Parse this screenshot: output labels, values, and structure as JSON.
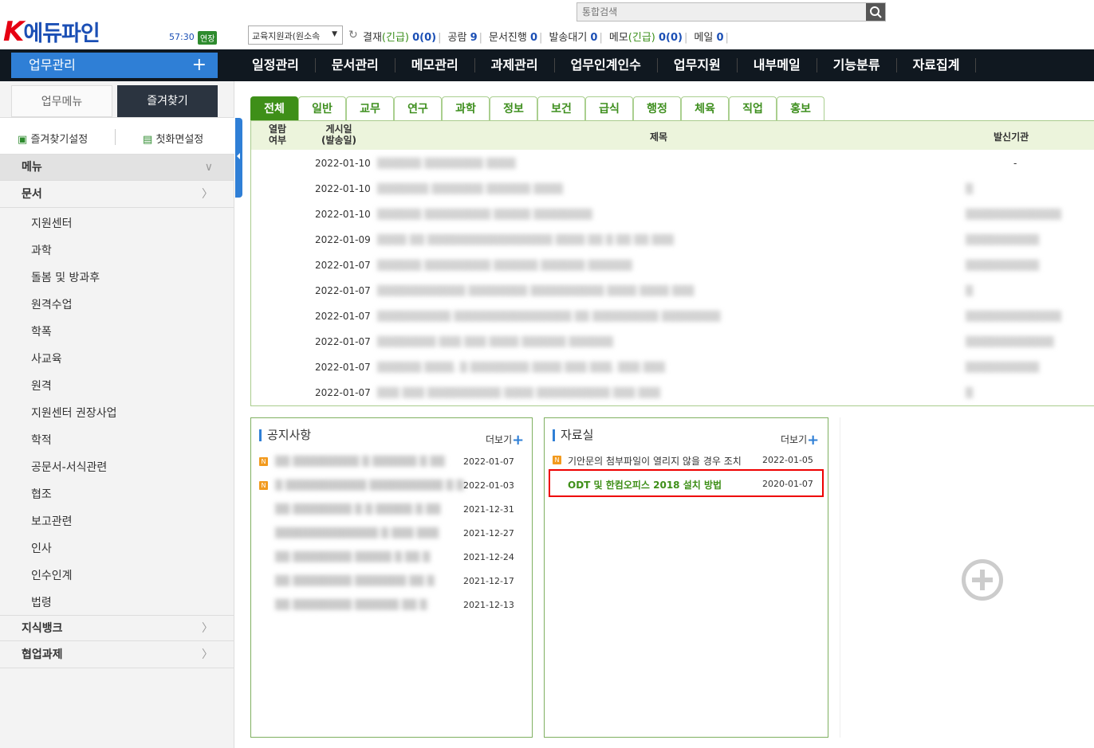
{
  "header": {
    "logo_k": "K",
    "logo_text": "에듀파인",
    "timer": "57:30",
    "extend": "연장",
    "search_placeholder": "통합검색",
    "dept": "교육지원과(원소속",
    "status": [
      {
        "label": "결재",
        "paren": "(긴급)",
        "count": "0(0)"
      },
      {
        "label": "공람",
        "paren": "",
        "count": "9"
      },
      {
        "label": "문서진행",
        "paren": "",
        "count": "0"
      },
      {
        "label": "발송대기",
        "paren": "",
        "count": "0"
      },
      {
        "label": "메모",
        "paren": "(긴급)",
        "count": "0(0)"
      },
      {
        "label": "메일",
        "paren": "",
        "count": "0"
      }
    ]
  },
  "nav": {
    "home": "업무관리",
    "home_plus": "+",
    "items": [
      "일정관리",
      "문서관리",
      "메모관리",
      "과제관리",
      "업무인계인수",
      "업무지원",
      "내부메일",
      "기능분류",
      "자료집계"
    ]
  },
  "sidebar": {
    "tab1": "업무메뉴",
    "tab2": "즐겨찾기",
    "fav_settings": "즐겨찾기설정",
    "first_screen": "첫화면설정",
    "menu_head": "메뉴",
    "doc_head": "문서",
    "items": [
      "지원센터",
      "과학",
      "돌봄 및 방과후",
      "원격수업",
      "학폭",
      "사교육",
      "원격",
      "지원센터 권장사업",
      "학적",
      "공문서-서식관련",
      "협조",
      "보고관련",
      "인사",
      "인수인계",
      "법령"
    ],
    "knowledge": "지식뱅크",
    "collab": "협업과제"
  },
  "tabs": [
    "전체",
    "일반",
    "교무",
    "연구",
    "과학",
    "정보",
    "보건",
    "급식",
    "행정",
    "체육",
    "직업",
    "홍보"
  ],
  "board": {
    "col_read": "열람\n여부",
    "col_date": "게시일\n(발송일)",
    "col_title": "제목",
    "col_sender": "발신기관",
    "rows": [
      {
        "date": "2022-01-10",
        "title": "▒▒▒▒▒▒ ▒▒▒▒▒▒▒▒ ▒▒▒▒",
        "sender": "-"
      },
      {
        "date": "2022-01-10",
        "title": "▒▒▒▒▒▒▒ ▒▒▒▒▒▒▒ ▒▒▒▒▒▒ ▒▒▒▒",
        "sender": "▒"
      },
      {
        "date": "2022-01-10",
        "title": "▒▒▒▒▒▒ ▒▒▒▒▒▒▒▒▒ ▒▒▒▒▒ ▒▒▒▒▒▒▒▒",
        "sender": "▒▒▒▒▒▒▒▒▒▒▒▒▒"
      },
      {
        "date": "2022-01-09",
        "title": "▒▒▒▒ ▒▒ ▒▒▒▒▒▒▒▒▒▒▒▒▒▒▒▒▒ ▒▒▒▒ ▒▒ ▒ ▒▒ ▒▒ ▒▒▒",
        "sender": "▒▒▒▒▒▒▒▒▒▒"
      },
      {
        "date": "2022-01-07",
        "title": "▒▒▒▒▒▒ ▒▒▒▒▒▒▒▒▒ ▒▒▒▒▒▒ ▒▒▒▒▒▒ ▒▒▒▒▒▒",
        "sender": "▒▒▒▒▒▒▒▒▒▒"
      },
      {
        "date": "2022-01-07",
        "title": "▒▒▒▒▒▒▒▒▒▒▒▒ ▒▒▒▒▒▒▒▒ ▒▒▒▒▒▒▒▒▒▒ ▒▒▒▒ ▒▒▒▒ ▒▒▒",
        "sender": "▒"
      },
      {
        "date": "2022-01-07",
        "title": "▒▒▒▒▒▒▒▒▒▒ ▒▒▒▒▒▒▒▒▒▒▒▒▒▒▒▒ ▒▒ ▒▒▒▒▒▒▒▒▒ ▒▒▒▒▒▒▒▒",
        "sender": "▒▒▒▒▒▒▒▒▒▒▒▒▒"
      },
      {
        "date": "2022-01-07",
        "title": "▒▒▒▒▒▒▒▒ ▒▒▒ ▒▒▒ ▒▒▒▒ ▒▒▒▒▒▒ ▒▒▒▒▒▒",
        "sender": "▒▒▒▒▒▒▒▒▒▒▒▒"
      },
      {
        "date": "2022-01-07",
        "title": "▒▒▒▒▒▒ ▒▒▒▒. ▒ ▒▒▒▒▒▒▒▒ ▒▒▒▒ ▒▒▒ ▒▒▒. ▒▒▒ ▒▒▒",
        "sender": "▒▒▒▒▒▒▒▒▒▒"
      },
      {
        "date": "2022-01-07",
        "title": "▒▒▒ ▒▒▒ ▒▒▒▒▒▒▒▒▒▒ ▒▒▒▒ ▒▒▒▒▒▒▒▒▒▒ ▒▒▒ ▒▒▒",
        "sender": "▒"
      }
    ]
  },
  "notice": {
    "title": "공지사항",
    "more": "더보기",
    "rows": [
      {
        "new": true,
        "title": "▒▒ ▒▒▒▒▒▒▒▒▒ ▒ ▒▒▒▒▒▒ ▒ ▒▒",
        "date": "2022-01-07"
      },
      {
        "new": true,
        "title": "▒ ▒▒▒▒▒▒▒▒▒▒▒ ▒▒▒▒▒▒▒▒▒▒ ▒ ▒",
        "date": "2022-01-03"
      },
      {
        "new": false,
        "title": "▒▒ ▒▒▒▒▒▒▒▒ ▒ ▒ ▒▒▒▒▒ ▒ ▒▒",
        "date": "2021-12-31"
      },
      {
        "new": false,
        "title": "▒▒▒▒▒▒▒▒▒▒▒▒▒▒ ▒ ▒▒▒ ▒▒▒",
        "date": "2021-12-27"
      },
      {
        "new": false,
        "title": "▒▒ ▒▒▒▒▒▒▒▒ ▒▒▒▒▒ ▒ ▒▒ ▒",
        "date": "2021-12-24"
      },
      {
        "new": false,
        "title": "▒▒ ▒▒▒▒▒▒▒▒ ▒▒▒▒▒▒▒ ▒▒ ▒",
        "date": "2021-12-17"
      },
      {
        "new": false,
        "title": "▒▒ ▒▒▒▒▒▒▒▒ ▒▒▒▒▒▒ ▒▒ ▒",
        "date": "2021-12-13"
      }
    ]
  },
  "library": {
    "title": "자료실",
    "more": "더보기",
    "rows": [
      {
        "new": true,
        "title": "기안문의 첨부파일이 열리지 않을 경우 조치",
        "date": "2022-01-05"
      },
      {
        "new": false,
        "title": "ODT 및 한컴오피스 2018 설치 방법",
        "date": "2020-01-07"
      }
    ]
  },
  "colors": {
    "nav_bg": "#101820",
    "accent_blue": "#2f7fd6",
    "tab_green": "#3e8f18",
    "highlight": "#e00000"
  }
}
